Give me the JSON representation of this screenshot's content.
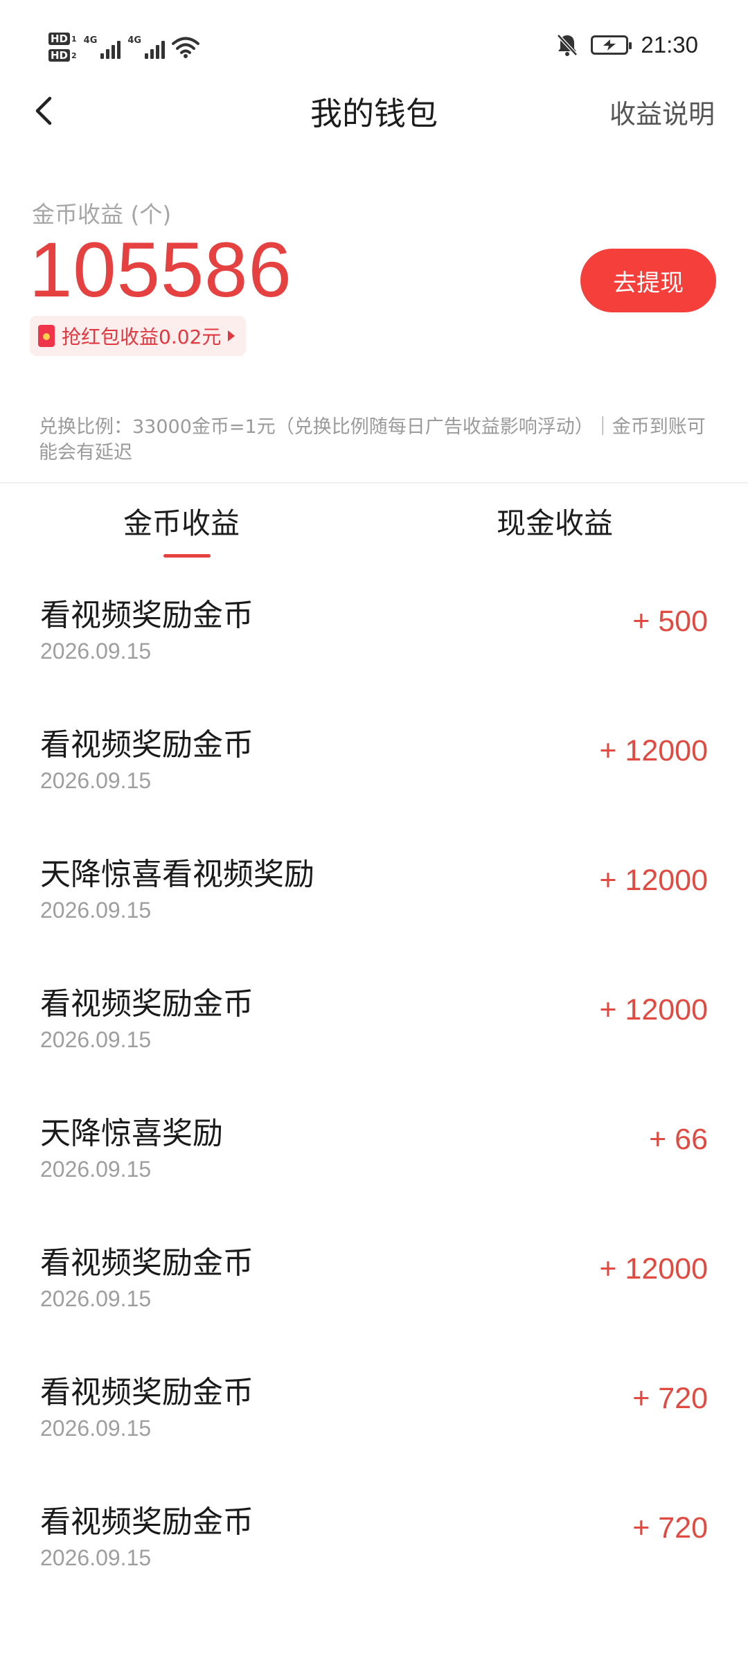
{
  "status_bar": {
    "hd1": "HD",
    "hd1_num": "1",
    "hd2": "HD",
    "hd2_num": "2",
    "net1": "4G",
    "net2": "4G",
    "time": "21:30",
    "icons": [
      "wifi-icon",
      "bell-off-icon",
      "battery-charging-icon"
    ]
  },
  "header": {
    "title": "我的钱包",
    "explain_link": "收益说明",
    "back_icon": "chevron-left-icon"
  },
  "balance": {
    "label": "金币收益 (个)",
    "amount": "105586",
    "withdraw_button": "去提现",
    "red_packet_text": "抢红包收益0.02元"
  },
  "ratio_note": "兑换比例：33000金币=1元（兑换比例随每日广告收益影响浮动）｜金币到账可能会有延迟",
  "tabs": [
    {
      "label": "金币收益",
      "active": true
    },
    {
      "label": "现金收益",
      "active": false
    }
  ],
  "records": [
    {
      "title": "看视频奖励金币",
      "date": "2026.09.15",
      "amount": "+ 500"
    },
    {
      "title": "看视频奖励金币",
      "date": "2026.09.15",
      "amount": "+ 12000"
    },
    {
      "title": "天降惊喜看视频奖励",
      "date": "2026.09.15",
      "amount": "+ 12000"
    },
    {
      "title": "看视频奖励金币",
      "date": "2026.09.15",
      "amount": "+ 12000"
    },
    {
      "title": "天降惊喜奖励",
      "date": "2026.09.15",
      "amount": "+ 66"
    },
    {
      "title": "看视频奖励金币",
      "date": "2026.09.15",
      "amount": "+ 12000"
    },
    {
      "title": "看视频奖励金币",
      "date": "2026.09.15",
      "amount": "+ 720"
    },
    {
      "title": "看视频奖励金币",
      "date": "2026.09.15",
      "amount": "+ 720"
    }
  ],
  "colors": {
    "accent": "#e54141",
    "button": "#f43f3a",
    "amount_text": "#e04a40",
    "muted_text": "#9e9e9e"
  }
}
